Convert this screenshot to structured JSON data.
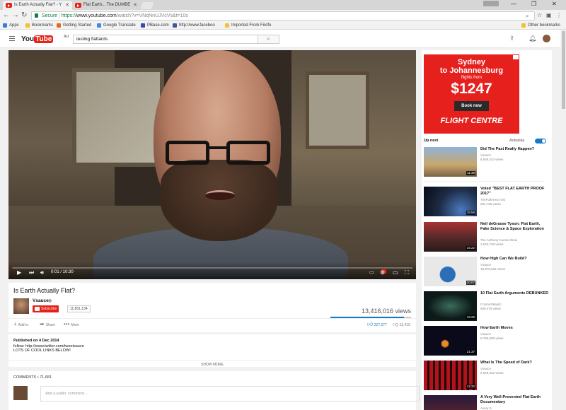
{
  "browser": {
    "tabs": [
      {
        "title": "Is Earth Actually Flat? - Y",
        "active": true
      },
      {
        "title": "Flat Earth... The DUMBE",
        "active": false
      }
    ],
    "secure_label": "Secure",
    "url_scheme": "https://",
    "url_host": "www.youtube.com",
    "url_rest": "/watch?v=VNqNnUJVcVs&t=10s",
    "bookmarks": [
      {
        "label": "Apps",
        "color": "#3a7bd5"
      },
      {
        "label": "Bookmarks",
        "color": "#f1c232"
      },
      {
        "label": "Getting Started",
        "color": "#e06c1f"
      },
      {
        "label": "Google Translate",
        "color": "#4285f4"
      },
      {
        "label": "PBase.com",
        "color": "#3949ab"
      },
      {
        "label": "http://www.faceboo",
        "color": "#3b5998"
      },
      {
        "label": "Imported From Firefo",
        "color": "#f1c232"
      }
    ],
    "other_bookmarks": "Other bookmarks"
  },
  "youtube": {
    "logo_you": "You",
    "logo_tube": "Tube",
    "logo_region": "AU",
    "search_value": "testing flattards"
  },
  "player": {
    "time_current": "0:01",
    "time_total": "10:30",
    "timecode": "0:01 / 10:30",
    "progress": 0.002
  },
  "video": {
    "title": "Is Earth Actually Flat?",
    "channel": "Vsauce",
    "subscribe_label": "Subscribe",
    "subscriber_count": "11,851,134",
    "views": "13,416,016 views",
    "add_to": "Add to",
    "share": "Share",
    "more": "More",
    "likes": "227,277",
    "dislikes": "13,419",
    "like_ratio": 0.944
  },
  "description": {
    "published": "Published on 4 Dec 2014",
    "line1": "follow: http://www.twitter.com/tweetsauce",
    "line2": "LOTS OF COOL LINKS BELOW!",
    "show_more": "SHOW MORE"
  },
  "comments": {
    "header": "COMMENTS • 71,681",
    "placeholder": "Add a public comment..."
  },
  "ad": {
    "line1": "Sydney",
    "line2": "to Johannesburg",
    "line3": "flights from",
    "price": "$1247",
    "button": "Book now",
    "brand": "FLIGHT CENTRE"
  },
  "sidebar": {
    "up_next": "Up next",
    "autoplay": "Autoplay",
    "items": [
      {
        "title": "Did The Past Really Happen?",
        "channel": "Vsauce",
        "views": "6,926,243 views",
        "duration": "11:38",
        "thumb": "#c9a66b"
      },
      {
        "title": "Voted \"BEST FLAT EARTH PROOF 2017\"",
        "channel": "TheFullArmor OG",
        "views": "291,766 views",
        "duration": "19:59",
        "thumb": "#1d2b45"
      },
      {
        "title": "Neil deGrasse Tyson: Flat Earth, Fake Science & Space Exploration",
        "channel": "The Anthony Cumia Show",
        "views": "1,522,748 views",
        "duration": "15:22",
        "thumb": "#5a2a2a"
      },
      {
        "title": "How High Can We Build?",
        "channel": "Vsauce",
        "views": "16,978,026 views",
        "duration": "10:07",
        "thumb": "#e8e8e8"
      },
      {
        "title": "10 Flat Earth Arguments DEBUNKED",
        "channel": "CosmicSkeptic",
        "views": "506,476 views",
        "duration": "18:26",
        "thumb": "#0d1a1a"
      },
      {
        "title": "How Earth Moves",
        "channel": "Vsauce",
        "views": "6,786,585 views",
        "duration": "21:37",
        "thumb": "#0a0a1a"
      },
      {
        "title": "What Is The Speed of Dark?",
        "channel": "Vsauce",
        "views": "9,648,402 views",
        "duration": "12:32",
        "thumb": "#b3121c"
      },
      {
        "title": "A Very Well-Presented Flat Earth Documentary",
        "channel": "Avery S.",
        "views": "",
        "duration": "",
        "thumb": "#2a1a3a"
      }
    ]
  }
}
